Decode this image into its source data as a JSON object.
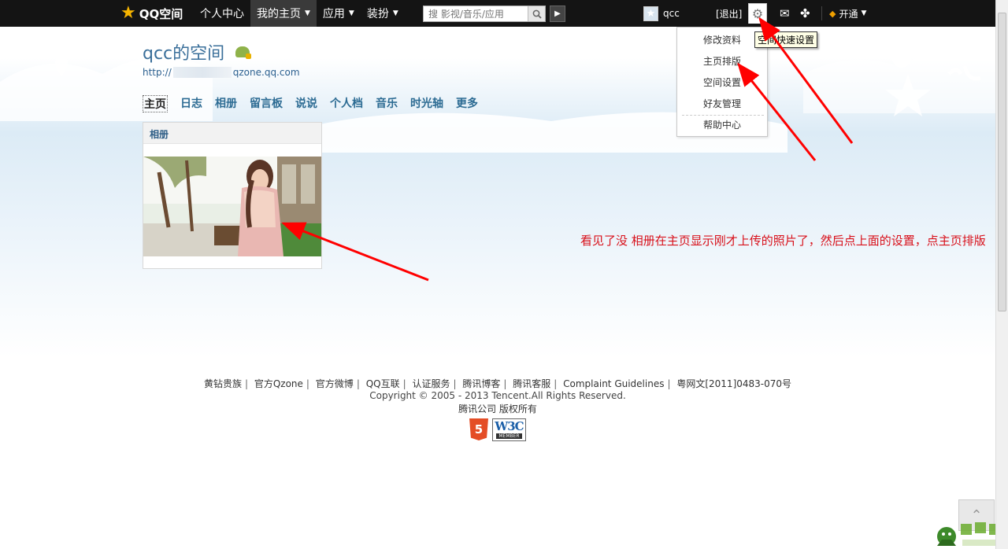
{
  "topbar": {
    "logo_text": "QQ空间",
    "nav": [
      {
        "label": "个人中心"
      },
      {
        "label": "我的主页"
      },
      {
        "label": "应用"
      },
      {
        "label": "装扮"
      }
    ],
    "search_placeholder": "搜 影视/音乐/应用",
    "username": "qcc",
    "logout_label": "[退出]",
    "kaitong_label": "开通"
  },
  "header": {
    "title": "qcc的空间",
    "url_prefix": "http://",
    "url_suffix": "qzone.qq.com"
  },
  "tabs": [
    {
      "label": "主页"
    },
    {
      "label": "日志"
    },
    {
      "label": "相册"
    },
    {
      "label": "留言板"
    },
    {
      "label": "说说"
    },
    {
      "label": "个人档"
    },
    {
      "label": "音乐"
    },
    {
      "label": "时光轴"
    },
    {
      "label": "更多"
    }
  ],
  "album": {
    "title": "相册"
  },
  "dropdown": {
    "items": [
      {
        "label": "修改资料"
      },
      {
        "label": "主页排版"
      },
      {
        "label": "空间设置"
      },
      {
        "label": "好友管理"
      },
      {
        "label": "帮助中心"
      }
    ]
  },
  "tooltip": "空间快速设置",
  "annotation": "看见了没  相册在主页显示刚才上传的照片了，然后点上面的设置，点主页排版",
  "footer": {
    "links": [
      {
        "label": "黄钻贵族"
      },
      {
        "label": "官方Qzone"
      },
      {
        "label": "官方微博"
      },
      {
        "label": "QQ互联"
      },
      {
        "label": "认证服务"
      },
      {
        "label": "腾讯博客"
      },
      {
        "label": "腾讯客服"
      },
      {
        "label": "Complaint Guidelines"
      },
      {
        "label": "粤网文[2011]0483-070号"
      }
    ],
    "copyright": "Copyright © 2005 - 2013 Tencent.All Rights Reserved.",
    "company": "腾讯公司 版权所有",
    "html5_badge": "5",
    "w3c_badge": "W3C",
    "w3c_member": "MEMBER"
  },
  "colors": {
    "topbar_bg": "#141414",
    "link_blue": "#2c6b93",
    "annotation_red": "#d8101a",
    "arrow_red": "#ff0000"
  }
}
